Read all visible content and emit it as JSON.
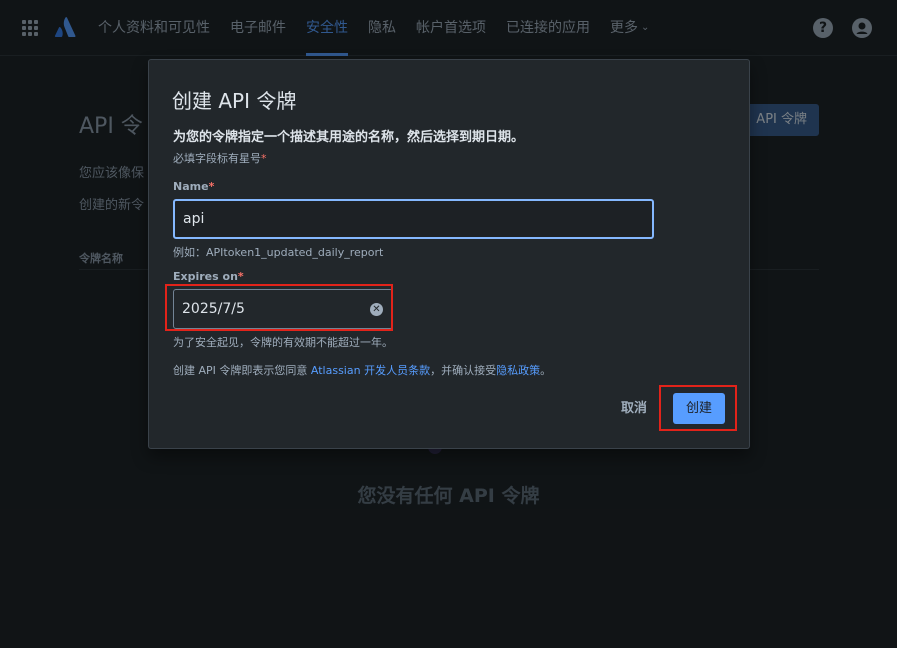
{
  "nav": {
    "items": [
      {
        "label": "个人资料和可见性",
        "active": false
      },
      {
        "label": "电子邮件",
        "active": false
      },
      {
        "label": "安全性",
        "active": true
      },
      {
        "label": "隐私",
        "active": false
      },
      {
        "label": "帐户首选项",
        "active": false
      },
      {
        "label": "已连接的应用",
        "active": false
      }
    ],
    "more_label": "更多",
    "more_icon": "chevron-down-icon",
    "help_icon": "help-icon",
    "account_icon": "account-icon",
    "apps_icon": "app-switcher-icon",
    "logo": "atlassian-logo",
    "active_color": "#579dff"
  },
  "background": {
    "title": "API 令",
    "text1": "您应该像保",
    "text2": "创建的新令",
    "column_header": "令牌名称",
    "create_button": "API 令牌",
    "empty_state": "您没有任何 API 令牌"
  },
  "modal": {
    "title": "创建 API 令牌",
    "description": "为您的令牌指定一个描述其用途的名称，然后选择到期日期。",
    "required_note": "必填字段标有星号",
    "name_label": "Name",
    "name_value": "api",
    "name_hint": "例如：APItoken1_updated_daily_report",
    "expires_label": "Expires on",
    "expires_value": "2025/7/5",
    "expiry_hint": "为了安全起见，令牌的有效期不能超过一年。",
    "terms_prefix": "创建 API 令牌即表示您同意 ",
    "terms_link": "Atlassian 开发人员条款",
    "terms_middle": "，并确认接受",
    "privacy_link": "隐私政策",
    "terms_suffix": "。",
    "cancel_label": "取消",
    "create_label": "创建",
    "asterisk": "*"
  },
  "colors": {
    "primary_button": "#579dff",
    "highlight_box": "#e2231a",
    "asterisk": "#f87168"
  }
}
